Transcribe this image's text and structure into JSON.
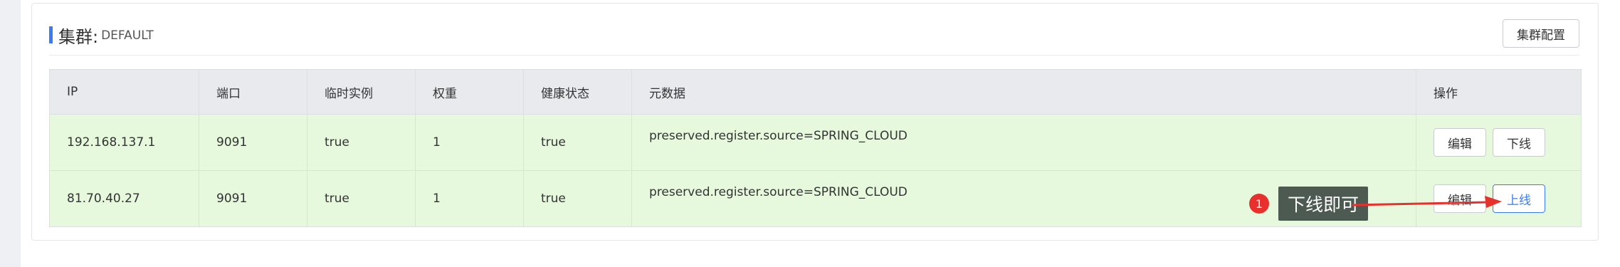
{
  "cluster": {
    "title_label": "集群:",
    "name": "DEFAULT",
    "config_button": "集群配置"
  },
  "table": {
    "columns": [
      "IP",
      "端口",
      "临时实例",
      "权重",
      "健康状态",
      "元数据",
      "操作"
    ],
    "rows": [
      {
        "ip": "192.168.137.1",
        "port": "9091",
        "ephemeral": "true",
        "weight": "1",
        "healthy": "true",
        "metadata": "preserved.register.source=SPRING_CLOUD",
        "edit": "编辑",
        "toggle": "下线"
      },
      {
        "ip": "81.70.40.27",
        "port": "9091",
        "ephemeral": "true",
        "weight": "1",
        "healthy": "true",
        "metadata": "preserved.register.source=SPRING_CLOUD",
        "edit": "编辑",
        "toggle": "上线"
      }
    ]
  },
  "annotation": {
    "number": "1",
    "text": "下线即可"
  },
  "colors": {
    "accent": "#3a7cf3",
    "row_highlight": "#e6f9dd",
    "annotation_red": "#e8302c"
  }
}
